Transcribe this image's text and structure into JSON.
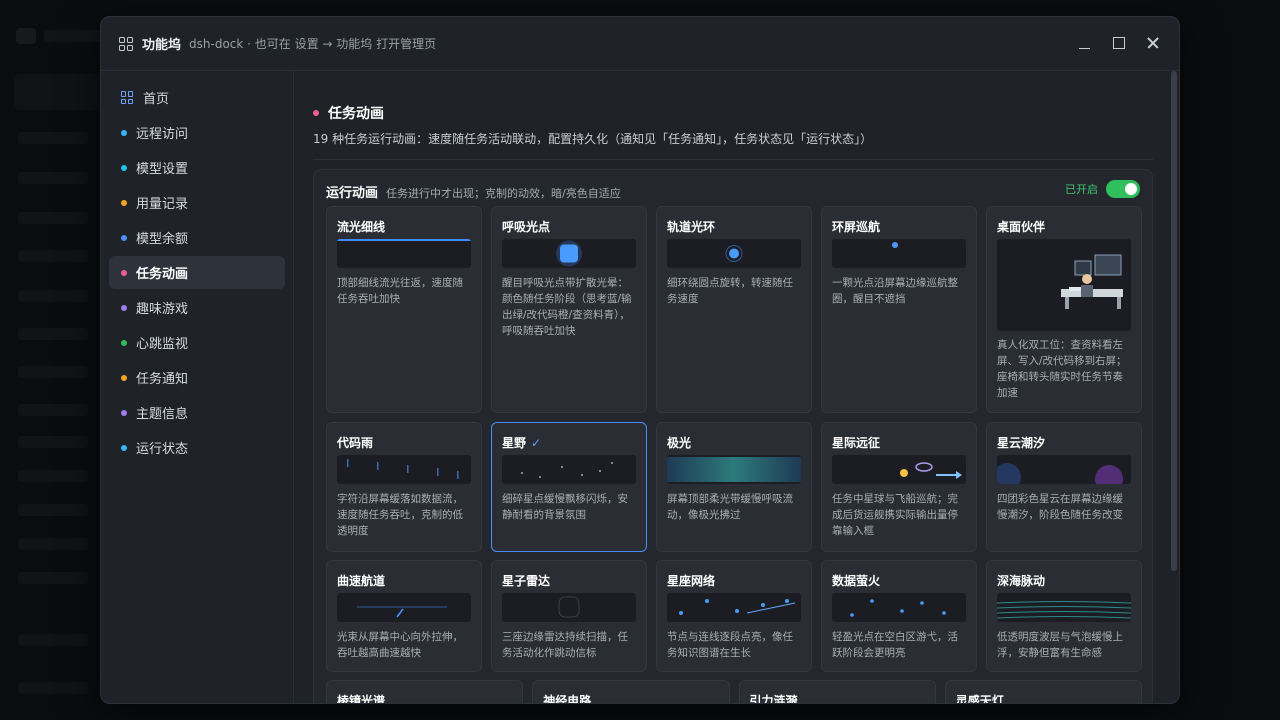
{
  "window": {
    "title": "功能坞",
    "subtitle": "dsh-dock · 也可在 设置 → 功能坞 打开管理页"
  },
  "sidebar": {
    "items": [
      {
        "label": "首页",
        "color": "#6ea3ff",
        "icon": "grid-icon"
      },
      {
        "label": "远程访问",
        "color": "#38b6ff"
      },
      {
        "label": "模型设置",
        "color": "#22c3e6"
      },
      {
        "label": "用量记录",
        "color": "#f5a524"
      },
      {
        "label": "模型余额",
        "color": "#4f8ff7"
      },
      {
        "label": "任务动画",
        "color": "#f25c9b",
        "active": true
      },
      {
        "label": "趣味游戏",
        "color": "#a07cf0"
      },
      {
        "label": "心跳监视",
        "color": "#2fbf5c"
      },
      {
        "label": "任务通知",
        "color": "#f5a524"
      },
      {
        "label": "主题信息",
        "color": "#a07cf0"
      },
      {
        "label": "运行状态",
        "color": "#38b6ff"
      }
    ]
  },
  "page": {
    "title": "任务动画",
    "description": "19 种任务运行动画：速度随任务活动联动，配置持久化（通知见「任务通知」，任务状态见「运行状态」）"
  },
  "section": {
    "title": "运行动画",
    "subtitle": "任务进行中才出现；克制的动效，暗/亮色自适应",
    "toggle_label": "已开启"
  },
  "cards": [
    {
      "title": "流光细线",
      "desc": "顶部细线流光往返，速度随任务吞吐加快"
    },
    {
      "title": "呼吸光点",
      "desc": "醒目呼吸光点带扩散光晕：颜色随任务阶段（思考蓝/输出绿/改代码橙/查资料青），呼吸随吞吐加快"
    },
    {
      "title": "轨道光环",
      "desc": "细环绕圆点旋转，转速随任务速度"
    },
    {
      "title": "环屏巡航",
      "desc": "一颗光点沿屏幕边缘巡航整圈，醒目不遮挡"
    },
    {
      "title": "桌面伙伴",
      "desc": "真人化双工位：查资料看左屏、写入/改代码移到右屏；座椅和转头随实时任务节奏加速"
    },
    {
      "title": "代码雨",
      "desc": "字符沿屏幕缓落如数据流，速度随任务吞吐，克制的低透明度"
    },
    {
      "title": "星野",
      "desc": "细碎星点缓慢飘移闪烁，安静耐看的背景氛围",
      "selected": true,
      "check": "✓"
    },
    {
      "title": "极光",
      "desc": "屏幕顶部柔光带缓慢呼吸流动，像极光拂过"
    },
    {
      "title": "星际远征",
      "desc": "任务中星球与飞船巡航；完成后货运舰携实际输出量停靠输入框"
    },
    {
      "title": "星云潮汐",
      "desc": "四团彩色星云在屏幕边缘缓慢潮汐，阶段色随任务改变"
    },
    {
      "title": "曲速航道",
      "desc": "光束从屏幕中心向外拉伸，吞吐越高曲速越快"
    },
    {
      "title": "星子雷达",
      "desc": "三座边缘雷达持续扫描，任务活动化作跳动信标"
    },
    {
      "title": "星座网络",
      "desc": "节点与连线逐段点亮，像任务知识图谱在生长"
    },
    {
      "title": "数据萤火",
      "desc": "轻盈光点在空白区游弋，活跃阶段会更明亮"
    },
    {
      "title": "深海脉动",
      "desc": "低透明度波层与气泡缓慢上浮，安静但富有生命感"
    },
    {
      "title": "棱镜光谱",
      "desc": ""
    },
    {
      "title": "神经电路",
      "desc": ""
    },
    {
      "title": "引力涟漪",
      "desc": ""
    },
    {
      "title": "灵感天灯",
      "desc": ""
    }
  ]
}
